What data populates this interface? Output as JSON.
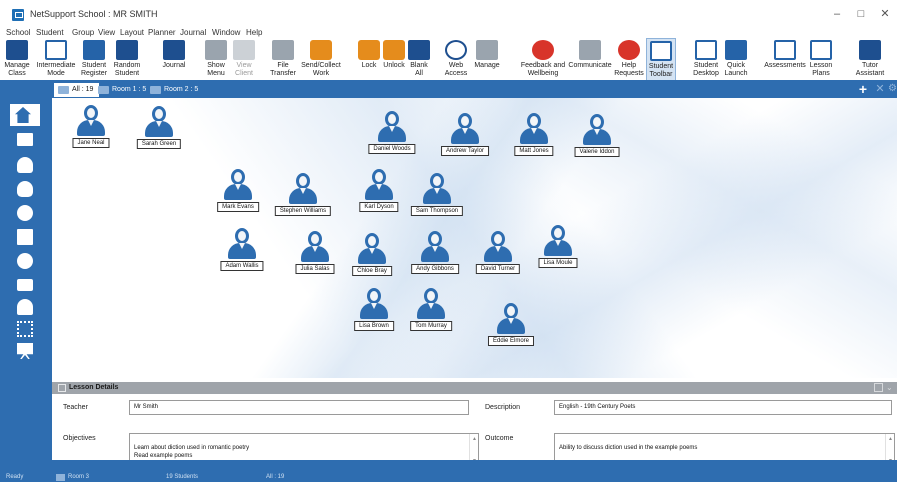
{
  "window": {
    "title": "NetSupport School : MR SMITH",
    "minimize": "–",
    "maximize": "□",
    "close": "✕"
  },
  "menu": [
    "School",
    "Student",
    "Group",
    "View",
    "Layout",
    "Planner",
    "Journal",
    "Window",
    "Help"
  ],
  "toolbar": [
    {
      "id": "manage-class",
      "label": "Manage\nClass",
      "icon": "manage-class-icon"
    },
    {
      "id": "intermediate-mode",
      "label": "Intermediate\nMode",
      "icon": "intermediate-mode-icon"
    },
    {
      "id": "student-register",
      "label": "Student\nRegister",
      "icon": "student-register-icon"
    },
    {
      "id": "random-student",
      "label": "Random\nStudent",
      "icon": "random-student-icon"
    },
    {
      "id": "journal",
      "label": "Journal",
      "icon": "journal-icon"
    },
    {
      "id": "show-menu",
      "label": "Show\nMenu",
      "icon": "show-menu-icon"
    },
    {
      "id": "view-client",
      "label": "View\nClient",
      "icon": "view-client-icon",
      "disabled": true
    },
    {
      "id": "file-transfer",
      "label": "File\nTransfer",
      "icon": "file-transfer-icon"
    },
    {
      "id": "send-collect-work",
      "label": "Send/Collect\nWork",
      "icon": "send-collect-work-icon"
    },
    {
      "id": "lock",
      "label": "Lock",
      "icon": "lock-icon"
    },
    {
      "id": "unlock",
      "label": "Unlock",
      "icon": "unlock-icon"
    },
    {
      "id": "blank-all",
      "label": "Blank\nAll",
      "icon": "blank-screen-icon"
    },
    {
      "id": "web-access",
      "label": "Web\nAccess",
      "icon": "globe-icon"
    },
    {
      "id": "manage",
      "label": "Manage",
      "icon": "manage-icon"
    },
    {
      "id": "feedback-wellbeing",
      "label": "Feedback and\nWellbeing",
      "icon": "feedback-wellbeing-icon"
    },
    {
      "id": "communicate",
      "label": "Communicate",
      "icon": "communicate-icon"
    },
    {
      "id": "help-requests",
      "label": "Help\nRequests",
      "icon": "lifebuoy-icon"
    },
    {
      "id": "student-toolbar",
      "label": "Student\nToolbar",
      "icon": "student-toolbar-icon",
      "active": true
    },
    {
      "id": "student-desktop",
      "label": "Student\nDesktop",
      "icon": "student-desktop-icon"
    },
    {
      "id": "quick-launch",
      "label": "Quick\nLaunch",
      "icon": "quick-launch-icon"
    },
    {
      "id": "assessments",
      "label": "Assessments",
      "icon": "assessments-icon"
    },
    {
      "id": "lesson-plans",
      "label": "Lesson\nPlans",
      "icon": "lesson-plans-icon"
    },
    {
      "id": "tutor-assistant",
      "label": "Tutor\nAssistant",
      "icon": "tutor-assistant-icon"
    }
  ],
  "tabs": [
    {
      "label": "All : 19",
      "selected": true
    },
    {
      "label": "Room 1 : 5",
      "selected": false
    },
    {
      "label": "Room 2 : 5",
      "selected": false
    }
  ],
  "tab_controls": {
    "add": "+",
    "close": "✕",
    "settings": "⚙"
  },
  "sidebar": [
    "home-icon",
    "monitor-icon",
    "headset-icon",
    "lightbulb-icon",
    "globe-icon",
    "window-icon",
    "clock-icon",
    "printer-icon",
    "group-icon",
    "grid-icon",
    "easel-icon"
  ],
  "students": [
    "Jane Neal",
    "Sarah Green",
    "Daniel Woods",
    "Andrew Taylor",
    "Matt Jones",
    "Valerie Iddon",
    "Mark Evans",
    "Stephen Williams",
    "Karl Dyson",
    "Sam Thompson",
    "Adam Wallis",
    "Julia Salas",
    "Chloe Bray",
    "Andy Gibbons",
    "David Turner",
    "Lisa Moule",
    "Lisa Brown",
    "Tom Murray",
    "Eddie Elmore"
  ],
  "lesson": {
    "header": "Lesson Details",
    "teacher_label": "Teacher",
    "teacher": "Mr Smith",
    "description_label": "Description",
    "description": "English - 19th Century Poets",
    "objectives_label": "Objectives",
    "objectives": "Learn about diction used in romantic poetry\nRead example poems",
    "outcome_label": "Outcome",
    "outcome": "Ability to discuss diction used in the example poems"
  },
  "status": {
    "ready": "Ready",
    "room": "Room 3",
    "students": "19 Students",
    "group": "All : 19"
  },
  "colors": {
    "accent": "#2e6db0",
    "panel_header": "#9fa4aa",
    "student_label_border": "#333333"
  }
}
